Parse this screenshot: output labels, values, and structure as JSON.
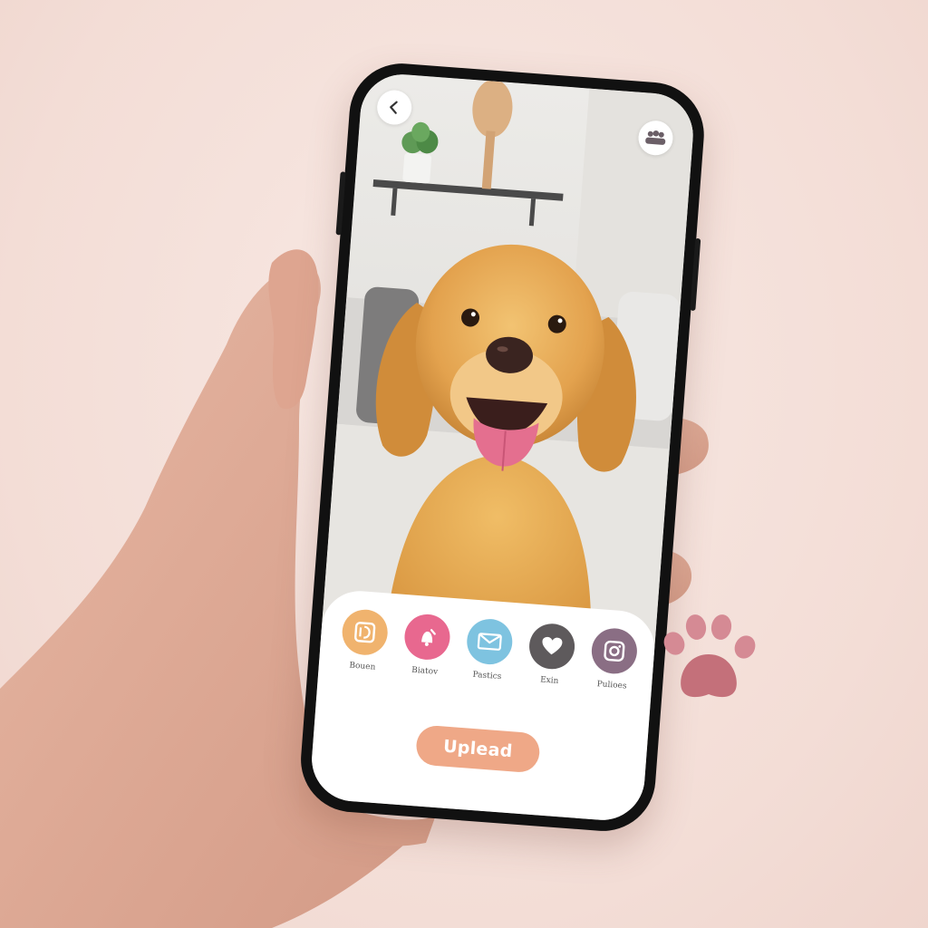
{
  "upload_button": {
    "label": "Uplead"
  },
  "share_options": [
    {
      "label": "Bouen",
      "icon": "photo-book-icon",
      "color": "#f0b36e"
    },
    {
      "label": "Biatov",
      "icon": "dog-bell-icon",
      "color": "#e8688f"
    },
    {
      "label": "Pastics",
      "icon": "mail-icon",
      "color": "#7ec3e0"
    },
    {
      "label": "Exin",
      "icon": "heart-icon",
      "color": "#5e5a5c"
    },
    {
      "label": "Pulioes",
      "icon": "instagram-icon",
      "color": "#8a6e84"
    }
  ],
  "colors": {
    "background": "#f6e3dd",
    "accent": "#efa887",
    "paw": "#c4707a"
  },
  "icons": {
    "back": "chevron-left-icon",
    "share": "group-icon",
    "decoration": "paw-print-icon"
  }
}
